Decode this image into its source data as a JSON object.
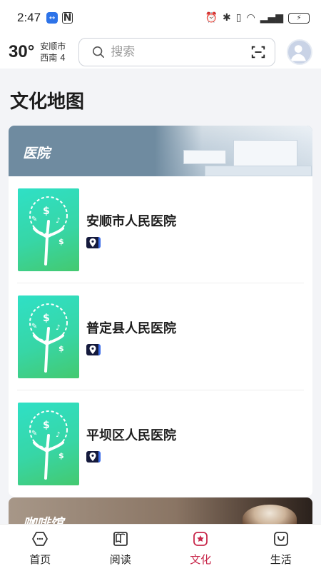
{
  "status_bar": {
    "time": "2:47"
  },
  "header": {
    "temperature": "30°",
    "city": "安顺市",
    "wind": "西南 4",
    "search_placeholder": "搜索"
  },
  "page": {
    "title": "文化地图"
  },
  "categories": [
    {
      "title": "医院",
      "items": [
        {
          "name": "安顺市人民医院"
        },
        {
          "name": "普定县人民医院"
        },
        {
          "name": "平坝区人民医院"
        }
      ]
    },
    {
      "title": "咖啡馆"
    }
  ],
  "tabbar": {
    "tabs": [
      {
        "label": "首页",
        "icon": "home-icon"
      },
      {
        "label": "阅读",
        "icon": "book-icon"
      },
      {
        "label": "文化",
        "icon": "culture-icon",
        "active": true
      },
      {
        "label": "生活",
        "icon": "life-bag-icon"
      }
    ],
    "active_color": "#c8284b"
  }
}
